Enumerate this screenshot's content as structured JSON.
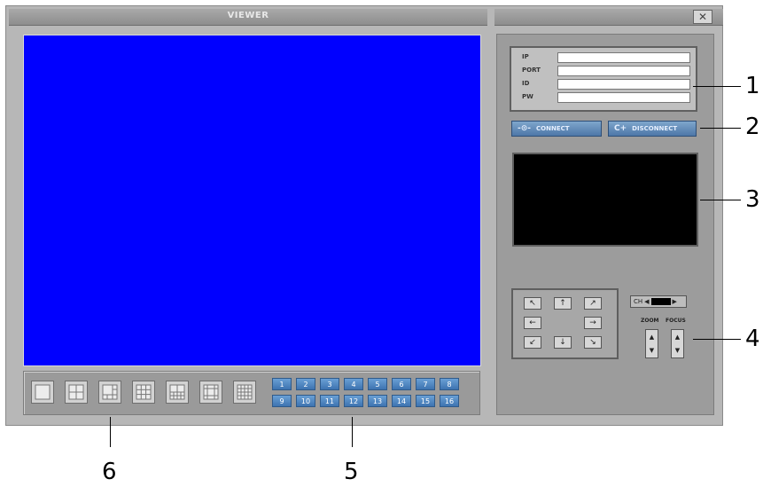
{
  "window": {
    "title": "VIEWER",
    "close_label": "✕"
  },
  "login": {
    "fields": [
      {
        "label": "IP",
        "value": ""
      },
      {
        "label": "PORT",
        "value": ""
      },
      {
        "label": "ID",
        "value": ""
      },
      {
        "label": "PW",
        "value": ""
      }
    ]
  },
  "actions": {
    "connect_label": "CONNECT",
    "connect_icon": "-⊙-",
    "disconnect_label": "DISCONNECT",
    "disconnect_icon": "C+"
  },
  "ptz": {
    "arrows": {
      "up_left": "↖",
      "up": "↑",
      "up_right": "↗",
      "left": "←",
      "right": "→",
      "down_left": "↙",
      "down": "↓",
      "down_right": "↘"
    },
    "channel_label": "CH",
    "channel_left": "◀",
    "channel_right": "▶",
    "zoom_label": "ZOOM",
    "focus_label": "FOCUS",
    "up_glyph": "▲",
    "down_glyph": "▼"
  },
  "channels": [
    "1",
    "2",
    "3",
    "4",
    "5",
    "6",
    "7",
    "8",
    "9",
    "10",
    "11",
    "12",
    "13",
    "14",
    "15",
    "16"
  ],
  "callouts": [
    "1",
    "2",
    "3",
    "4",
    "5",
    "6"
  ],
  "colors": {
    "video_bg": "#0000ff",
    "accent_button": "#4d77a8",
    "preview_bg": "#000000"
  }
}
